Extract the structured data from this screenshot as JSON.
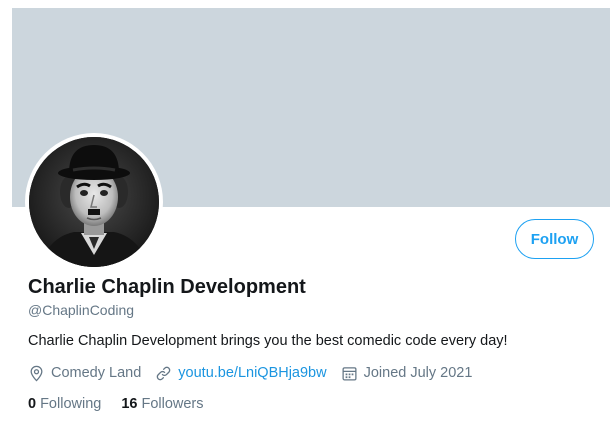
{
  "profile": {
    "display_name": "Charlie Chaplin Development",
    "handle": "@ChaplinCoding",
    "bio": "Charlie Chaplin Development brings you the best comedic code every day!",
    "location": "Comedy Land",
    "website": "youtu.be/LniQBHja9bw",
    "joined": "Joined July 2021",
    "follow_label": "Follow"
  },
  "stats": {
    "following_count": "0",
    "following_label": "Following",
    "followers_count": "16",
    "followers_label": "Followers"
  },
  "colors": {
    "banner": "#ccd6dd",
    "accent": "#1da1f2",
    "secondary_text": "#657786"
  },
  "icons": {
    "location": "location-pin-icon",
    "link": "link-icon",
    "calendar": "calendar-icon"
  }
}
